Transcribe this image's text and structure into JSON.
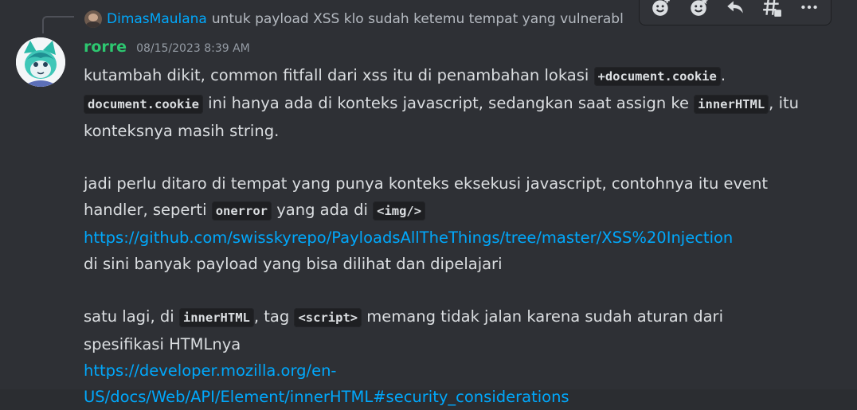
{
  "reply": {
    "author": "DimasMaulana",
    "text": "untuk payload XSS klo sudah ketemu tempat yang vulnerabl"
  },
  "toolbar": {
    "buttons": [
      "add-reaction-icon",
      "super-reaction-icon",
      "reply-icon",
      "create-thread-icon",
      "more-icon"
    ]
  },
  "message": {
    "author": "rorre",
    "timestamp": "08/15/2023 8:39 AM",
    "p1_a": "kutambah dikit, common fitfall dari xss itu di penambahan lokasi ",
    "p1_code1": "+document.cookie",
    "p1_b": ". ",
    "p1_code2": "document.cookie",
    "p1_c": " ini hanya ada di konteks javascript, sedangkan saat assign ke ",
    "p1_code3": "innerHTML",
    "p1_d": ", itu konteksnya masih string.",
    "p2_a": "jadi perlu ditaro di tempat yang punya konteks eksekusi javascript, contohnya itu event handler, seperti ",
    "p2_code1": "onerror",
    "p2_b": " yang ada di ",
    "p2_code2": "<img/>",
    "p2_link": "https://github.com/swisskyrepo/PayloadsAllTheThings/tree/master/XSS%20Injection",
    "p2_c": "di sini banyak payload yang bisa dilihat dan dipelajari",
    "p3_a": "satu lagi, di ",
    "p3_code1": "innerHTML",
    "p3_b": ", tag ",
    "p3_code2": "<script>",
    "p3_c": " memang tidak jalan karena sudah aturan dari spesifikasi HTMLnya",
    "p3_link": "https://developer.mozilla.org/en-US/docs/Web/API/Element/innerHTML#security_considerations"
  },
  "colors": {
    "author": "#2dc770",
    "link": "#00a8fc",
    "background": "#2e3035"
  }
}
